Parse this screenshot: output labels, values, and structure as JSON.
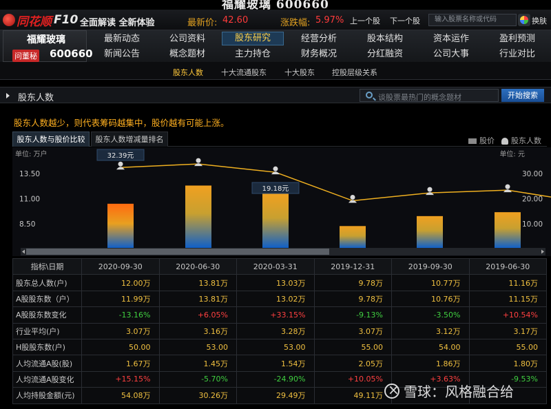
{
  "window_title": "福耀玻璃 600660",
  "topbar": {
    "logo_text": "同花顺",
    "logo_suffix": "F10",
    "slogan": "全面解读 全新体验",
    "price_label": "最新价:",
    "price_value": "42.60",
    "change_label": "涨跌幅:",
    "change_value": "5.97%",
    "prev_label": "上一个股",
    "next_label": "下一个股",
    "search_placeholder": "输入股票名称或代码",
    "switch_label": "换肤"
  },
  "stock": {
    "name": "福耀玻璃",
    "badge": "问董秘",
    "code": "600660"
  },
  "nav": {
    "row1": [
      "最新动态",
      "公司资料",
      "股东研究",
      "经营分析",
      "股本结构",
      "资本运作",
      "盈利预测"
    ],
    "row2": [
      "新闻公告",
      "概念题材",
      "主力持仓",
      "财务概况",
      "分红融资",
      "公司大事",
      "行业对比"
    ],
    "active": "股东研究"
  },
  "subnav": [
    "股东人数",
    "十大流通股东",
    "十大股东",
    "控股层级关系"
  ],
  "section": {
    "title": "股东人数",
    "search_placeholder": "谈股票最热门的概念题材",
    "search_button": "开始搜索"
  },
  "tip": "股东人数越少，则代表筹码越集中，股价越有可能上涨。",
  "chart_tabs": [
    "股东人数与股价比较",
    "股东人数增减量排名"
  ],
  "legend": {
    "price": "股价",
    "holders": "股东人数"
  },
  "chart_data": {
    "type": "bar",
    "categories": [
      "2020-09-30",
      "2020-06-30",
      "2020-03-31",
      "2019-12-31",
      "2019-09-30",
      "2019-06-30"
    ],
    "series": [
      {
        "name": "股东人数",
        "type": "bar",
        "values": [
          12.0,
          13.81,
          13.03,
          9.78,
          10.77,
          11.16
        ]
      },
      {
        "name": "股价",
        "type": "line",
        "values": [
          32.39,
          33.8,
          30.5,
          19.18,
          22.3,
          23.4
        ]
      }
    ],
    "y_left": {
      "label": "单位: 万户",
      "ticks": [
        "13.50",
        "11.00",
        "8.50"
      ]
    },
    "y_right": {
      "label": "单位: 元",
      "ticks": [
        "30.00",
        "20.00",
        "10.00"
      ]
    },
    "tooltips": [
      "32.39元",
      "19.18元"
    ],
    "colors": {
      "line": "#f0b020",
      "bar_top": "#f0a020",
      "bar_bottom": "#1070d0"
    }
  },
  "table": {
    "corner": "指标\\日期",
    "dates": [
      "2020-09-30",
      "2020-06-30",
      "2020-03-31",
      "2019-12-31",
      "2019-09-30",
      "2019-06-30"
    ],
    "rows": [
      {
        "label": "股东总人数(户)",
        "values": [
          "12.00万",
          "13.81万",
          "13.03万",
          "9.78万",
          "10.77万",
          "11.16万"
        ],
        "kind": "plain"
      },
      {
        "label": "A股股东数（户）",
        "values": [
          "11.99万",
          "13.81万",
          "13.02万",
          "9.78万",
          "10.76万",
          "11.15万"
        ],
        "kind": "plain"
      },
      {
        "label": "A股股东数变化",
        "values": [
          "-13.16%",
          "+6.05%",
          "+33.15%",
          "-9.13%",
          "-3.50%",
          "+10.54%"
        ],
        "kind": "signed"
      },
      {
        "label": "行业平均(户)",
        "values": [
          "3.07万",
          "3.16万",
          "3.28万",
          "3.07万",
          "3.12万",
          "3.17万"
        ],
        "kind": "plain"
      },
      {
        "label": "H股股东数(户)",
        "values": [
          "50.00",
          "53.00",
          "53.00",
          "55.00",
          "54.00",
          "55.00"
        ],
        "kind": "plain"
      },
      {
        "label": "人均流通A股(股)",
        "values": [
          "1.67万",
          "1.45万",
          "1.54万",
          "2.05万",
          "1.86万",
          "1.80万"
        ],
        "kind": "plain"
      },
      {
        "label": "人均流通A股变化",
        "values": [
          "+15.15%",
          "-5.70%",
          "-24.90%",
          "+10.05%",
          "+3.63%",
          "-9.53%"
        ],
        "kind": "signed"
      },
      {
        "label": "人均持股金额(元)",
        "values": [
          "54.08万",
          "30.26万",
          "29.49万",
          "49.11万",
          "",
          ""
        ],
        "kind": "plain"
      }
    ]
  },
  "watermark": "雪球：风格融合给"
}
